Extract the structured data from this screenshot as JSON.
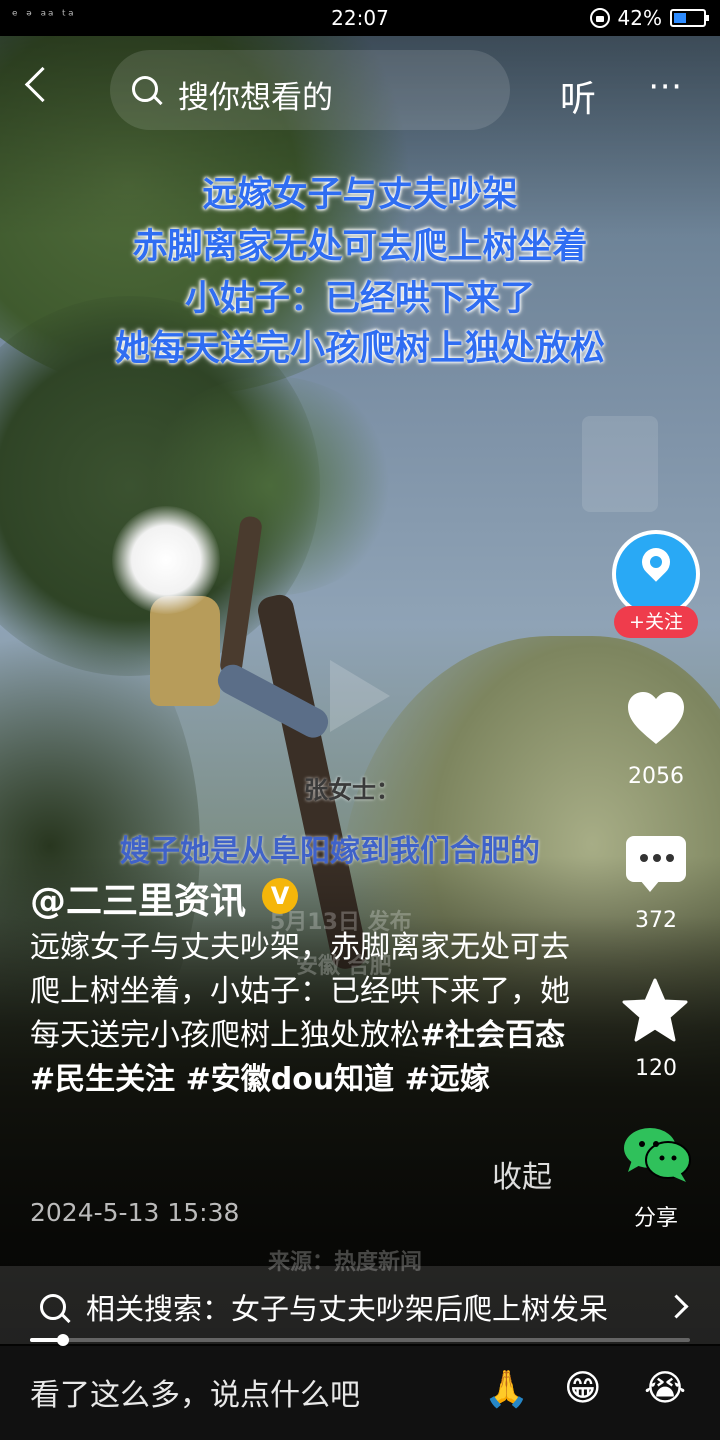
{
  "status_bar": {
    "time": "22:07",
    "battery": "42%",
    "battery_level": 0.42,
    "left_icons": "ᵉ ᵊ ᵃᵃ ᵗᵃ"
  },
  "top_bar": {
    "search_placeholder": "搜你想看的",
    "listen_label": "听",
    "more_label": "⋯"
  },
  "video": {
    "headline_lines": [
      "远嫁女子与丈夫吵架",
      "赤脚离家无处可去爬上树坐着",
      "小姑子：已经哄下来了",
      "她每天送完小孩爬树上独处放松"
    ],
    "speaker": "张女士：",
    "subtitle": "嫂子她是从阜阳嫁到我们合肥的",
    "date_overlay": "5月13日 发布",
    "location_overlay": "安徽 合肥",
    "source_overlay": "来源：热度新闻"
  },
  "sidebar": {
    "follow_label": "+关注",
    "likes": "2056",
    "comments": "372",
    "favorites": "120",
    "share_label": "分享"
  },
  "post": {
    "author": "@二三里资讯",
    "verified_badge": "V",
    "description": "远嫁女子与丈夫吵架，赤脚离家无处可去爬上树坐着，小姑子：已经哄下来了，她每天送完小孩爬树上独处放松",
    "hashtags": [
      "#社会百态",
      " #民生关注",
      " #安徽dou知道",
      " #远嫁"
    ],
    "collapse_label": "收起",
    "timestamp": "2024-5-13 15:38"
  },
  "related_search": {
    "text": "相关搜索：女子与丈夫吵架后爬上树发呆"
  },
  "playback": {
    "progress": 0.05
  },
  "bottom_bar": {
    "comment_placeholder": "看了这么多，说点什么吧",
    "emojis": [
      "🙏",
      "😁",
      "😭"
    ]
  },
  "colors": {
    "accent_red": "#ef3c4c",
    "avatar_blue": "#29a9f5",
    "verified_gold": "#f5b60a",
    "headline_blue": "#2f6df2"
  }
}
